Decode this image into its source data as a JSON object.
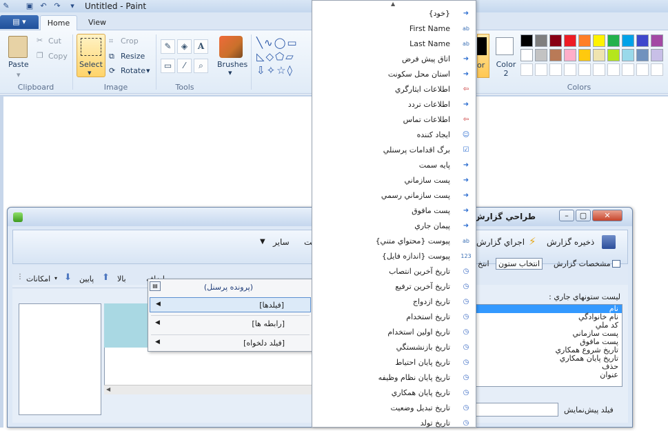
{
  "paint": {
    "title": "Untitled - Paint",
    "tabs": {
      "home": "Home",
      "view": "View"
    },
    "clipboard": {
      "paste": "Paste",
      "cut": "Cut",
      "copy": "Copy",
      "group": "Clipboard"
    },
    "image": {
      "select": "Select",
      "crop": "Crop",
      "resize": "Resize",
      "rotate": "Rotate",
      "group": "Image"
    },
    "tools": {
      "group": "Tools",
      "text_tool": "A"
    },
    "brushes": {
      "label": "Brushes"
    },
    "color1_label": "or",
    "color2_label": "Color 2",
    "colors_group": "Colors",
    "palette": [
      "#000000",
      "#7f7f7f",
      "#880015",
      "#ed1c24",
      "#ff7f27",
      "#fff200",
      "#22b14c",
      "#00a2e8",
      "#3f48cc",
      "#a349a4",
      "#ffffff",
      "#c3c3c3",
      "#b97a57",
      "#ffaec9",
      "#ffc90e",
      "#efe4b0",
      "#b5e61d",
      "#99d9ea",
      "#7092be",
      "#c8bfe7"
    ]
  },
  "report_window": {
    "title": "طراحي گزارش",
    "toolbar": {
      "save": "ذخيره گزارش",
      "run": "اجراي گزارش",
      "other": "ساير",
      "partial": "يت"
    },
    "tabs": {
      "specs": "مشخصات گزارش",
      "select_columns": "انتخاب ستون",
      "partial": "انتخ"
    },
    "current_columns_label": "ليست ستونهاي جاري :",
    "current_columns": [
      "نام",
      "نام خانوادگي",
      "کد ملي",
      "پست  سازماني",
      "پست مافوق",
      "تاريخ شروع همکاري",
      "تاريخ پايان همکاري",
      "حذف",
      "عنوان"
    ],
    "preview_field_label": "فيلد پيش‌نمايش",
    "fields_toolbar": {
      "options": "امکانات",
      "down": "پايين",
      "up": "بالا",
      "add": "اضافه"
    }
  },
  "context_menu": {
    "header": "(پرونده پرسنل)",
    "items": [
      "[فيلدها]",
      "[رابطه ها]",
      "[فيلد دلخواه]"
    ]
  },
  "field_list": [
    {
      "label": "{خود}",
      "icon": "arrow"
    },
    {
      "label": "First Name",
      "icon": "ab"
    },
    {
      "label": "Last Name",
      "icon": "ab"
    },
    {
      "label": "اتاق پيش فرض",
      "icon": "arrow"
    },
    {
      "label": "استان محل سکونت",
      "icon": "arrow"
    },
    {
      "label": "اطلاعات ايثارگري",
      "icon": "red-arrow"
    },
    {
      "label": "اطلاعات تردد",
      "icon": "arrow"
    },
    {
      "label": "اطلاعات تماس",
      "icon": "red-arrow"
    },
    {
      "label": "ايجاد کننده",
      "icon": "user"
    },
    {
      "label": "برگ اقدامات پرسنلي",
      "icon": "check"
    },
    {
      "label": "پايه سمت",
      "icon": "arrow"
    },
    {
      "label": "پست  سازماني",
      "icon": "arrow"
    },
    {
      "label": "پست سازماني رسمي",
      "icon": "arrow"
    },
    {
      "label": "پست مافوق",
      "icon": "arrow"
    },
    {
      "label": "پيمان جاري",
      "icon": "arrow"
    },
    {
      "label": "پيوست {محتواي متني}",
      "icon": "ab"
    },
    {
      "label": "پيوست {اندازه فايل}",
      "icon": "123"
    },
    {
      "label": "تاريخ آخرين انتصاب",
      "icon": "clock"
    },
    {
      "label": "تاريخ آخرين ترفيع",
      "icon": "clock"
    },
    {
      "label": "تاريخ ازدواج",
      "icon": "clock"
    },
    {
      "label": "تاريخ استخدام",
      "icon": "clock"
    },
    {
      "label": "تاريخ اولين استخدام",
      "icon": "clock"
    },
    {
      "label": "تاريخ بازنشستگي",
      "icon": "clock"
    },
    {
      "label": "تاريخ پايان احتياط",
      "icon": "clock"
    },
    {
      "label": "تاريخ پايان نظام وظيفه",
      "icon": "clock"
    },
    {
      "label": "تاريخ پايان همکاري",
      "icon": "clock"
    },
    {
      "label": "تاريخ تبديل وضعيت",
      "icon": "clock"
    },
    {
      "label": "تاريخ تولد",
      "icon": "clock"
    }
  ]
}
